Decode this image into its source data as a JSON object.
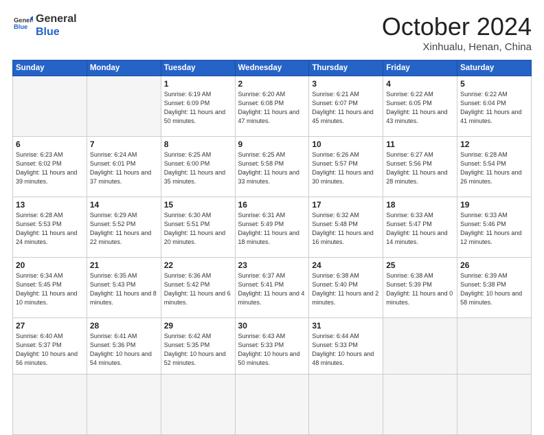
{
  "header": {
    "logo_general": "General",
    "logo_blue": "Blue",
    "month": "October 2024",
    "location": "Xinhualu, Henan, China"
  },
  "weekdays": [
    "Sunday",
    "Monday",
    "Tuesday",
    "Wednesday",
    "Thursday",
    "Friday",
    "Saturday"
  ],
  "days": [
    {
      "num": "",
      "info": ""
    },
    {
      "num": "",
      "info": ""
    },
    {
      "num": "1",
      "info": "Sunrise: 6:19 AM\nSunset: 6:09 PM\nDaylight: 11 hours and 50 minutes."
    },
    {
      "num": "2",
      "info": "Sunrise: 6:20 AM\nSunset: 6:08 PM\nDaylight: 11 hours and 47 minutes."
    },
    {
      "num": "3",
      "info": "Sunrise: 6:21 AM\nSunset: 6:07 PM\nDaylight: 11 hours and 45 minutes."
    },
    {
      "num": "4",
      "info": "Sunrise: 6:22 AM\nSunset: 6:05 PM\nDaylight: 11 hours and 43 minutes."
    },
    {
      "num": "5",
      "info": "Sunrise: 6:22 AM\nSunset: 6:04 PM\nDaylight: 11 hours and 41 minutes."
    },
    {
      "num": "6",
      "info": "Sunrise: 6:23 AM\nSunset: 6:02 PM\nDaylight: 11 hours and 39 minutes."
    },
    {
      "num": "7",
      "info": "Sunrise: 6:24 AM\nSunset: 6:01 PM\nDaylight: 11 hours and 37 minutes."
    },
    {
      "num": "8",
      "info": "Sunrise: 6:25 AM\nSunset: 6:00 PM\nDaylight: 11 hours and 35 minutes."
    },
    {
      "num": "9",
      "info": "Sunrise: 6:25 AM\nSunset: 5:58 PM\nDaylight: 11 hours and 33 minutes."
    },
    {
      "num": "10",
      "info": "Sunrise: 6:26 AM\nSunset: 5:57 PM\nDaylight: 11 hours and 30 minutes."
    },
    {
      "num": "11",
      "info": "Sunrise: 6:27 AM\nSunset: 5:56 PM\nDaylight: 11 hours and 28 minutes."
    },
    {
      "num": "12",
      "info": "Sunrise: 6:28 AM\nSunset: 5:54 PM\nDaylight: 11 hours and 26 minutes."
    },
    {
      "num": "13",
      "info": "Sunrise: 6:28 AM\nSunset: 5:53 PM\nDaylight: 11 hours and 24 minutes."
    },
    {
      "num": "14",
      "info": "Sunrise: 6:29 AM\nSunset: 5:52 PM\nDaylight: 11 hours and 22 minutes."
    },
    {
      "num": "15",
      "info": "Sunrise: 6:30 AM\nSunset: 5:51 PM\nDaylight: 11 hours and 20 minutes."
    },
    {
      "num": "16",
      "info": "Sunrise: 6:31 AM\nSunset: 5:49 PM\nDaylight: 11 hours and 18 minutes."
    },
    {
      "num": "17",
      "info": "Sunrise: 6:32 AM\nSunset: 5:48 PM\nDaylight: 11 hours and 16 minutes."
    },
    {
      "num": "18",
      "info": "Sunrise: 6:33 AM\nSunset: 5:47 PM\nDaylight: 11 hours and 14 minutes."
    },
    {
      "num": "19",
      "info": "Sunrise: 6:33 AM\nSunset: 5:46 PM\nDaylight: 11 hours and 12 minutes."
    },
    {
      "num": "20",
      "info": "Sunrise: 6:34 AM\nSunset: 5:45 PM\nDaylight: 11 hours and 10 minutes."
    },
    {
      "num": "21",
      "info": "Sunrise: 6:35 AM\nSunset: 5:43 PM\nDaylight: 11 hours and 8 minutes."
    },
    {
      "num": "22",
      "info": "Sunrise: 6:36 AM\nSunset: 5:42 PM\nDaylight: 11 hours and 6 minutes."
    },
    {
      "num": "23",
      "info": "Sunrise: 6:37 AM\nSunset: 5:41 PM\nDaylight: 11 hours and 4 minutes."
    },
    {
      "num": "24",
      "info": "Sunrise: 6:38 AM\nSunset: 5:40 PM\nDaylight: 11 hours and 2 minutes."
    },
    {
      "num": "25",
      "info": "Sunrise: 6:38 AM\nSunset: 5:39 PM\nDaylight: 11 hours and 0 minutes."
    },
    {
      "num": "26",
      "info": "Sunrise: 6:39 AM\nSunset: 5:38 PM\nDaylight: 10 hours and 58 minutes."
    },
    {
      "num": "27",
      "info": "Sunrise: 6:40 AM\nSunset: 5:37 PM\nDaylight: 10 hours and 56 minutes."
    },
    {
      "num": "28",
      "info": "Sunrise: 6:41 AM\nSunset: 5:36 PM\nDaylight: 10 hours and 54 minutes."
    },
    {
      "num": "29",
      "info": "Sunrise: 6:42 AM\nSunset: 5:35 PM\nDaylight: 10 hours and 52 minutes."
    },
    {
      "num": "30",
      "info": "Sunrise: 6:43 AM\nSunset: 5:33 PM\nDaylight: 10 hours and 50 minutes."
    },
    {
      "num": "31",
      "info": "Sunrise: 6:44 AM\nSunset: 5:33 PM\nDaylight: 10 hours and 48 minutes."
    },
    {
      "num": "",
      "info": ""
    },
    {
      "num": "",
      "info": ""
    },
    {
      "num": "",
      "info": ""
    }
  ]
}
